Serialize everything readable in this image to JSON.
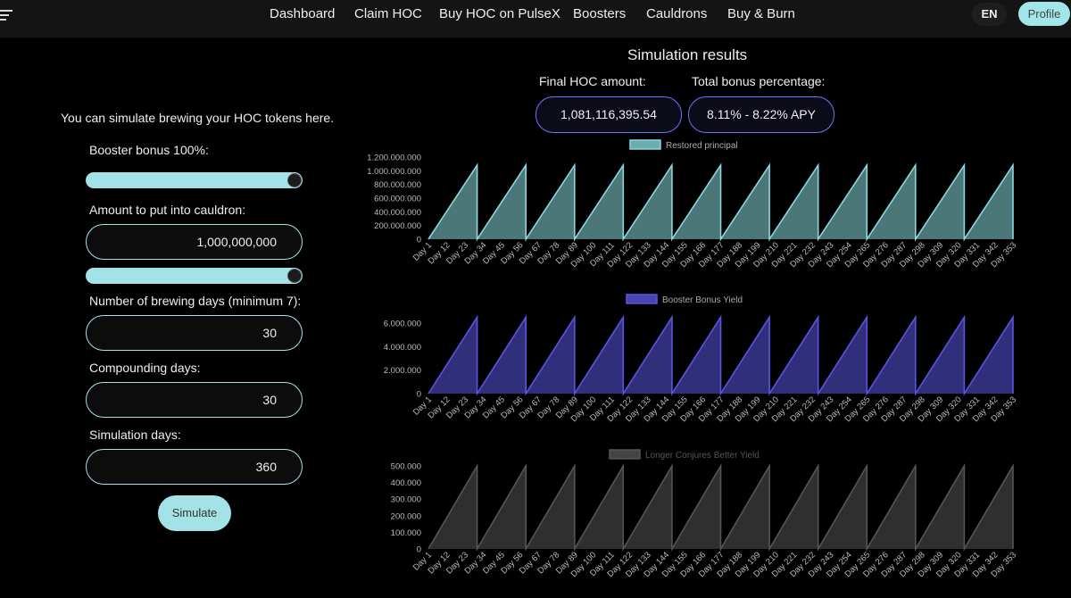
{
  "nav": {
    "menu_icon": "hamburger-menu-icon",
    "items": [
      "Dashboard",
      "Claim HOC",
      "Buy HOC on PulseX",
      "Boosters",
      "Cauldrons",
      "Buy & Burn"
    ],
    "lang": "EN",
    "profile": "Profile"
  },
  "simulator": {
    "intro": "You can simulate brewing your HOC tokens here.",
    "booster_label": "Booster bonus 100%:",
    "booster_percent": 100,
    "amount_label": "Amount to put into cauldron:",
    "amount_value": "1,000,000,000",
    "amount_slider_percent": 100,
    "brewing_label": "Number of brewing days (minimum 7):",
    "brewing_value": "30",
    "compounding_label": "Compounding days:",
    "compounding_value": "30",
    "simulation_label": "Simulation days:",
    "simulation_value": "360",
    "simulate_button": "Simulate"
  },
  "results": {
    "title": "Simulation results",
    "final_label": "Final HOC amount:",
    "final_value": "1,081,116,395.54",
    "bonus_label": "Total bonus percentage:",
    "bonus_value": "8.11% - 8.22% APY"
  },
  "chart_data": [
    {
      "type": "area",
      "series": [
        {
          "name": "Restored principal",
          "color": "#88d8dc"
        }
      ],
      "x_labels": [
        "Day 1",
        "Day 12",
        "Day 23",
        "Day 34",
        "Day 45",
        "Day 56",
        "Day 67",
        "Day 78",
        "Day 89",
        "Day 100",
        "Day 111",
        "Day 122",
        "Day 133",
        "Day 144",
        "Day 155",
        "Day 166",
        "Day 177",
        "Day 188",
        "Day 199",
        "Day 210",
        "Day 221",
        "Day 232",
        "Day 243",
        "Day 254",
        "Day 265",
        "Day 276",
        "Day 287",
        "Day 298",
        "Day 309",
        "Day 320",
        "Day 331",
        "Day 342",
        "Day 353"
      ],
      "y_ticks": [
        "1.200.000.000",
        "1.000.000.000",
        "800.000.000",
        "600.000.000",
        "400.000.000",
        "200.000.000",
        "0"
      ],
      "ylim": [
        0,
        1200000000
      ],
      "cycle_days": 30,
      "cycle_peak": 1081000000,
      "cycles": 12
    },
    {
      "type": "area",
      "series": [
        {
          "name": "Booster Bonus Yield",
          "color": "#5a55e0"
        }
      ],
      "x_labels": [
        "Day 1",
        "Day 12",
        "Day 23",
        "Day 34",
        "Day 45",
        "Day 56",
        "Day 67",
        "Day 78",
        "Day 89",
        "Day 100",
        "Day 111",
        "Day 122",
        "Day 133",
        "Day 144",
        "Day 155",
        "Day 166",
        "Day 177",
        "Day 188",
        "Day 199",
        "Day 210",
        "Day 221",
        "Day 232",
        "Day 243",
        "Day 254",
        "Day 265",
        "Day 276",
        "Day 287",
        "Day 298",
        "Day 309",
        "Day 320",
        "Day 331",
        "Day 342",
        "Day 353"
      ],
      "y_ticks": [
        "6.000.000",
        "4.000.000",
        "2.000.000",
        "0"
      ],
      "ylim": [
        0,
        6000000
      ],
      "cycle_days": 30,
      "cycle_peak": 6500000,
      "cycles": 12
    },
    {
      "type": "area",
      "series": [
        {
          "name": "Longer Conjures Better Yield",
          "color": "#555555"
        }
      ],
      "x_labels": [
        "Day 1",
        "Day 12",
        "Day 23",
        "Day 34",
        "Day 45",
        "Day 56",
        "Day 67",
        "Day 78",
        "Day 89",
        "Day 100",
        "Day 111",
        "Day 122",
        "Day 133",
        "Day 144",
        "Day 155",
        "Day 166",
        "Day 177",
        "Day 188",
        "Day 199",
        "Day 210",
        "Day 221",
        "Day 232",
        "Day 243",
        "Day 254",
        "Day 265",
        "Day 276",
        "Day 287",
        "Day 298",
        "Day 309",
        "Day 320",
        "Day 331",
        "Day 342",
        "Day 353"
      ],
      "y_ticks": [
        "500.000",
        "400.000",
        "300.000",
        "200.000",
        "100.000",
        "0"
      ],
      "ylim": [
        0,
        500000
      ],
      "cycle_days": 30,
      "cycle_peak": 500000,
      "cycles": 12
    }
  ]
}
